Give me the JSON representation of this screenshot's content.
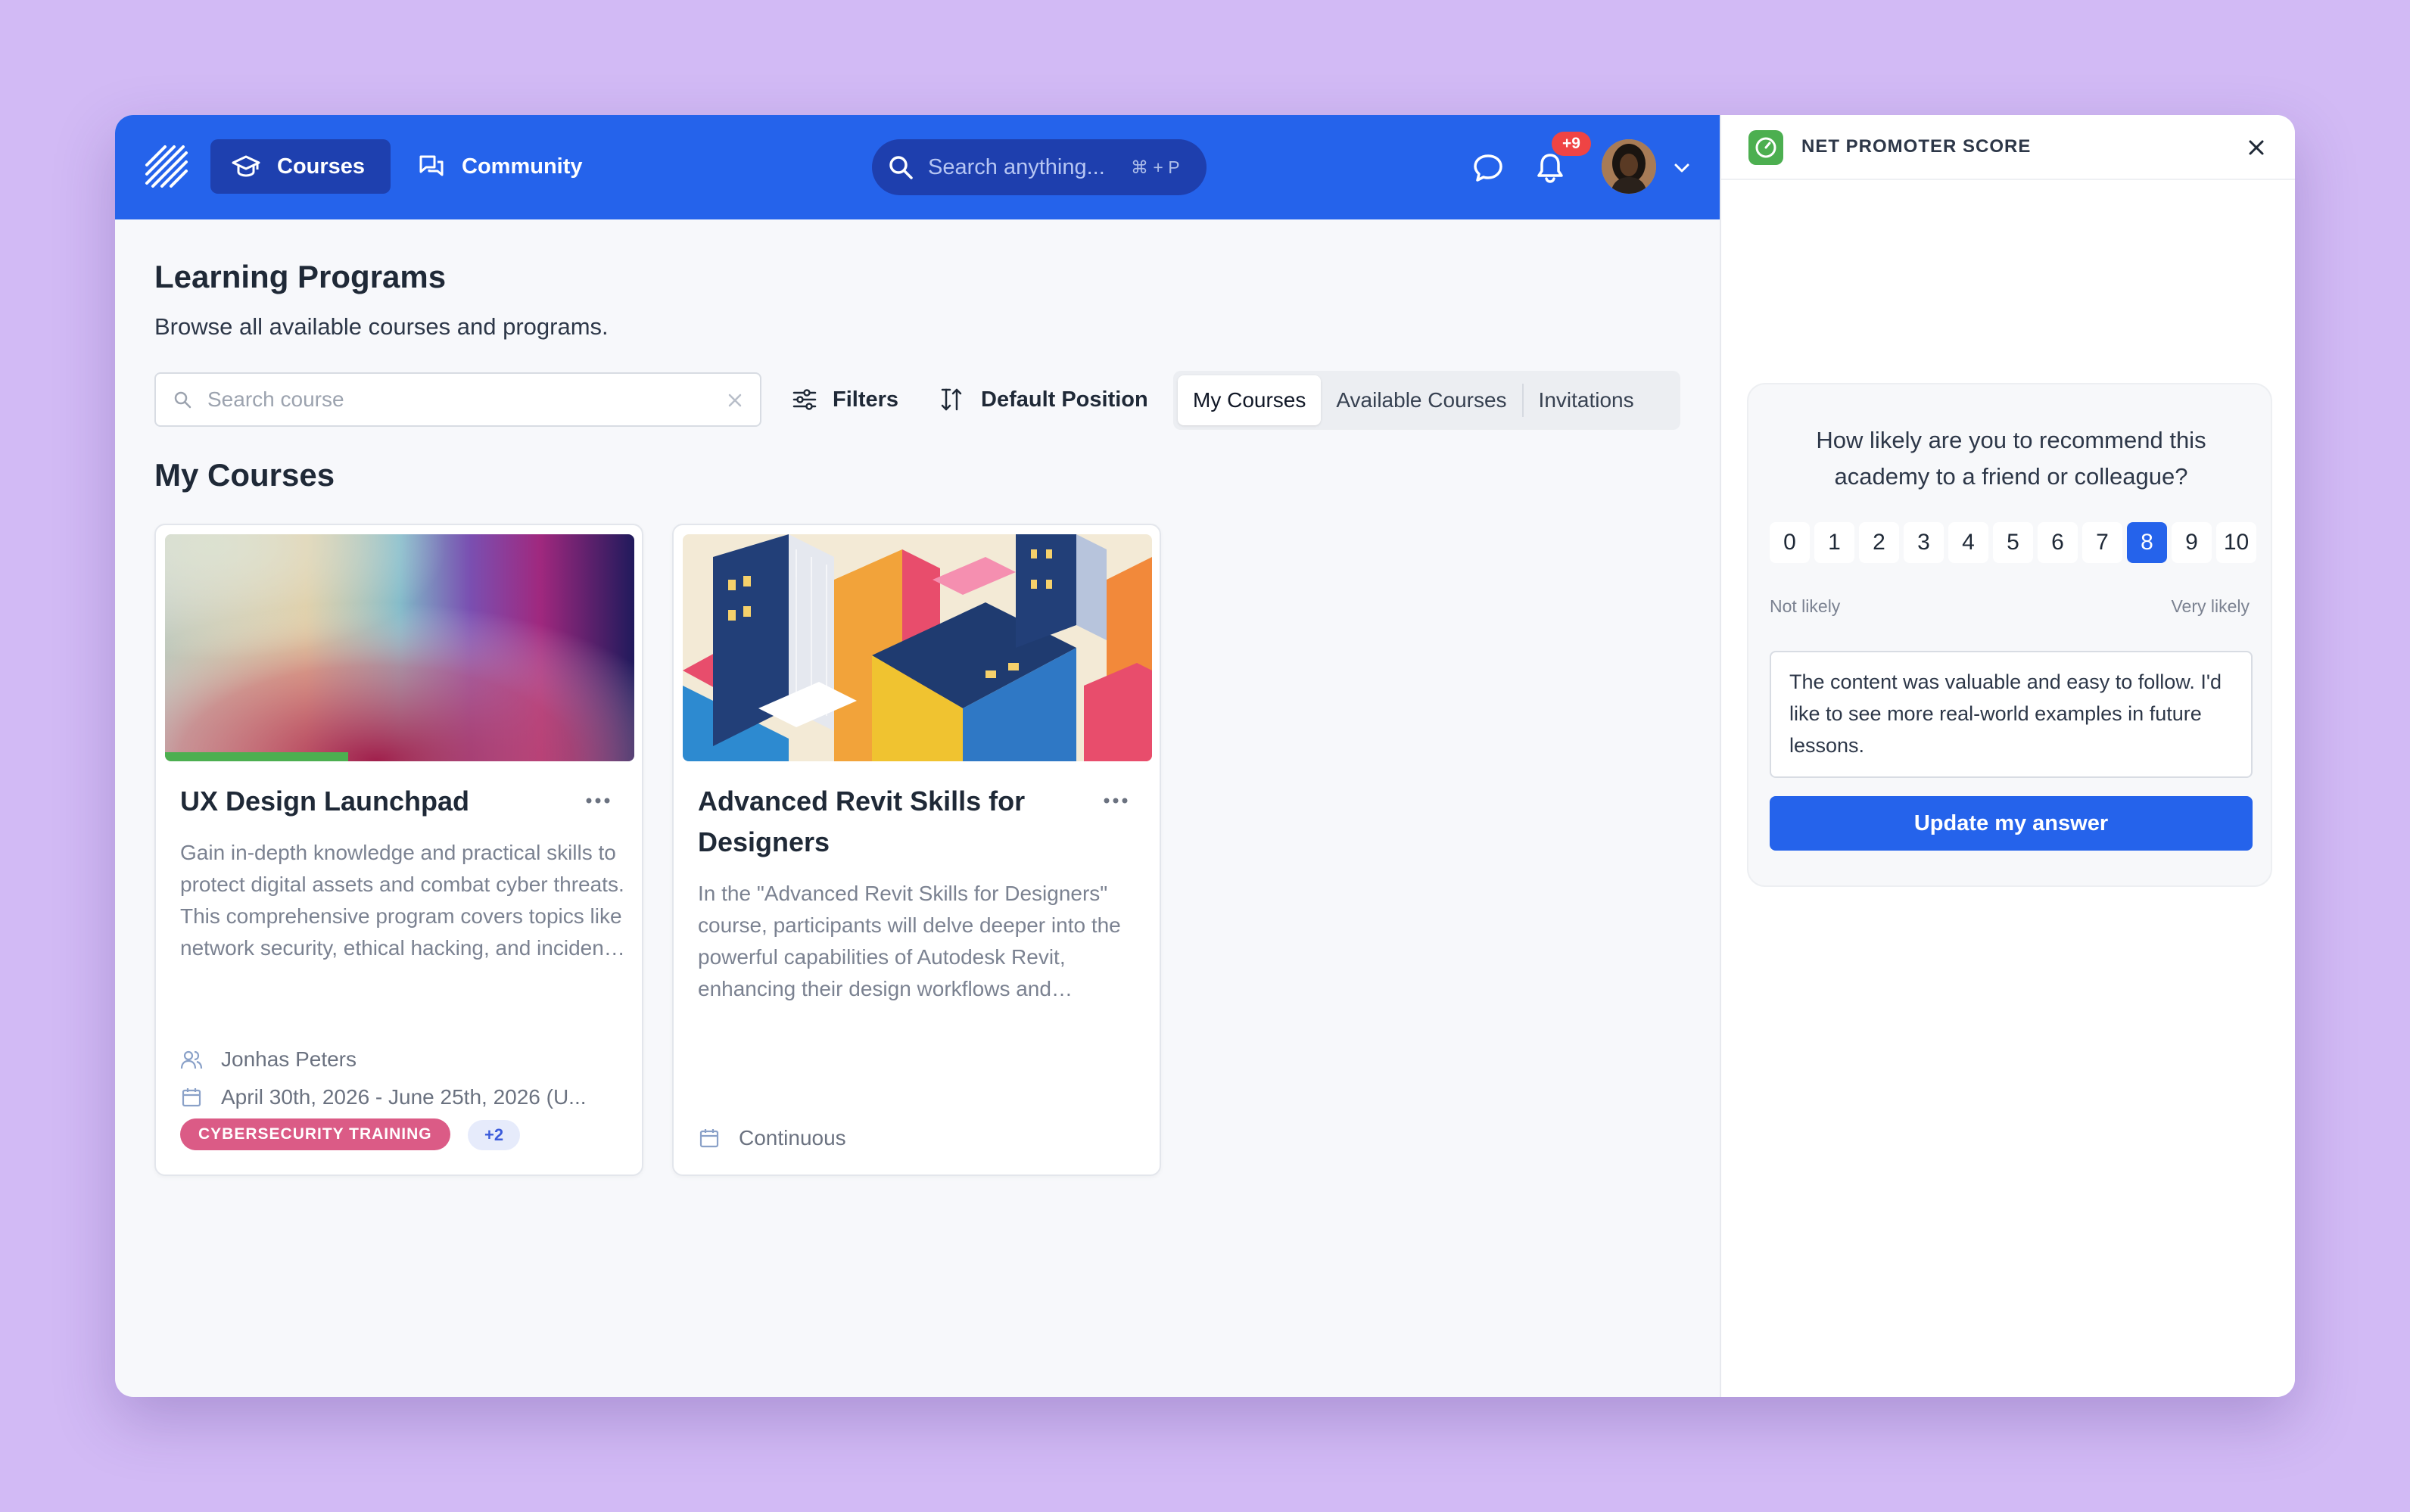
{
  "header": {
    "nav": [
      {
        "label": "Courses",
        "icon": "graduation-cap-icon",
        "active": true
      },
      {
        "label": "Community",
        "icon": "chat-bubbles-icon",
        "active": false
      }
    ],
    "search_placeholder": "Search anything...",
    "search_shortcut": "⌘ + P",
    "notification_count": "+9"
  },
  "main": {
    "title": "Learning Programs",
    "subtitle": "Browse all available courses and programs.",
    "course_search_placeholder": "Search course",
    "filters_label": "Filters",
    "sort_label": "Default Position",
    "tabs": [
      {
        "label": "My Courses",
        "active": true
      },
      {
        "label": "Available Courses",
        "active": false
      },
      {
        "label": "Invitations",
        "active": false
      }
    ],
    "section_title": "My Courses",
    "courses": [
      {
        "title": "UX Design Launchpad",
        "description": "Gain in-depth knowledge and practical skills to protect digital assets and combat cyber threats. This comprehensive program covers topics like network security, ethical hacking, and incident response.",
        "instructor": "Jonhas Peters",
        "dates": "April 30th, 2026 - June 25th, 2026 (U...",
        "tag": "CYBERSECURITY TRAINING",
        "extra_tags": "+2",
        "progress": 0.39
      },
      {
        "title": "Advanced Revit Skills for Designers",
        "description": "In the \"Advanced Revit Skills for Designers\" course, participants will delve deeper into the powerful capabilities of Autodesk Revit, enhancing their design workflows and productivity.",
        "schedule": "Continuous"
      }
    ]
  },
  "panel": {
    "title": "NET PROMOTER SCORE",
    "question": "How likely are you to recommend this academy to a friend or colleague?",
    "scale": [
      "0",
      "1",
      "2",
      "3",
      "4",
      "5",
      "6",
      "7",
      "8",
      "9",
      "10"
    ],
    "selected": "8",
    "low_label": "Not likely",
    "high_label": "Very likely",
    "feedback": "The content was valuable and easy to follow. I'd like to see more real-world examples in future lessons.",
    "submit_label": "Update my answer"
  },
  "colors": {
    "brand": "#2563eb",
    "nav_active": "#1e40af",
    "tag": "#db5b86",
    "progress": "#4caf50"
  }
}
